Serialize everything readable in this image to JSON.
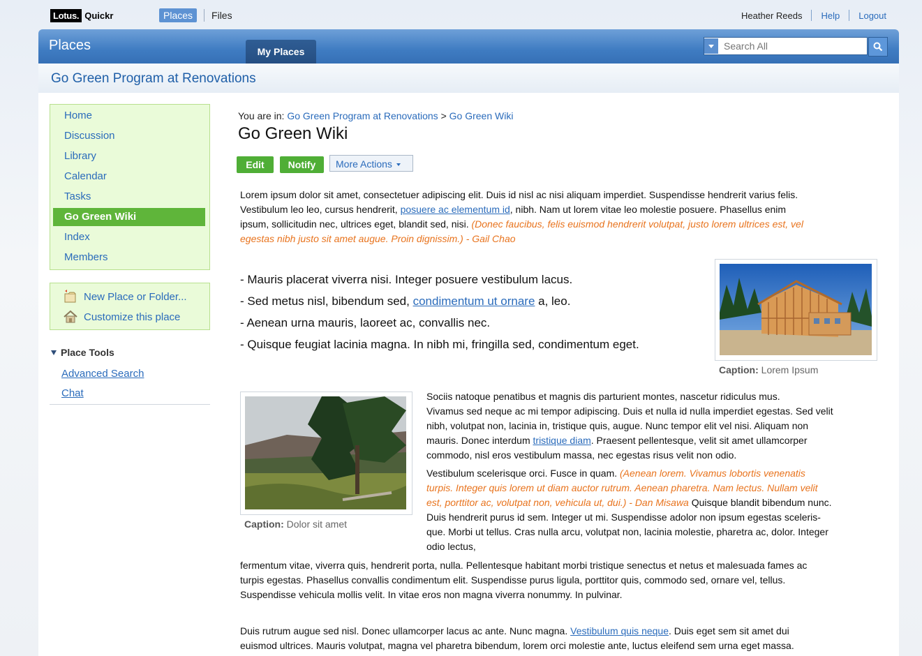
{
  "topbar": {
    "logo_lotus": "Lotus.",
    "logo_quickr": "Quickr",
    "tab_places": "Places",
    "tab_files": "Files",
    "user_name": "Heather Reeds",
    "help": "Help",
    "logout": "Logout"
  },
  "places_bar": {
    "title": "Places",
    "my_places_tab": "My Places",
    "search_placeholder": "Search All"
  },
  "place": {
    "name": "Go Green Program at Renovations"
  },
  "sidebar": {
    "items": [
      {
        "label": "Home"
      },
      {
        "label": "Discussion"
      },
      {
        "label": "Library"
      },
      {
        "label": "Calendar"
      },
      {
        "label": "Tasks"
      },
      {
        "label": "Go Green Wiki"
      },
      {
        "label": "Index"
      },
      {
        "label": "Members"
      }
    ],
    "actions": {
      "new_place": "New Place or Folder...",
      "customize": "Customize this place"
    },
    "tools_header": "Place Tools",
    "tools": {
      "advanced_search": "Advanced Search",
      "chat": "Chat"
    }
  },
  "main": {
    "breadcrumb_prefix": "You are in:",
    "breadcrumb_place": "Go Green Program at Renovations",
    "breadcrumb_sep": ">",
    "breadcrumb_page": "Go Green Wiki",
    "title": "Go Green Wiki",
    "btn_edit": "Edit",
    "btn_notify": "Notify",
    "btn_more": "More Actions",
    "p1_line1": "Lorem ipsum dolor sit amet, consectetuer adipiscing elit. Duis id nisl ac nisi aliquam imperdiet. Suspendisse hendrerit varius felis.",
    "p1_line2_pre": "Vestibulum leo leo, cursus hendrerit, ",
    "p1_link": "posuere ac elementum id",
    "p1_line2_post": ", nibh. Nam ut lorem vitae leo molestie posuere. Phasellus enim",
    "p1_line3_pre": "ipsum, sollicitudin nec, ultrices eget, blandit sed, nisi. ",
    "p1_quote_a": "(Donec faucibus, felis euismod hendrerit volutpat, justo lorem ultrices est, vel",
    "p1_quote_b": "egestas nibh justo sit amet augue. Proin dignissim.) - Gail Chao",
    "bullet1": "- Mauris placerat viverra nisi. Integer posuere vestibulum lacus.",
    "bullet2_pre": "- Sed metus nisl, bibendum sed, ",
    "bullet2_link": "condimentum ut ornare",
    "bullet2_post": " a, leo.",
    "bullet3": "- Aenean urna mauris, laoreet ac, convallis nec.",
    "bullet4": "- Quisque feugiat lacinia magna. In nibh mi, fringilla sed, condimentum eget.",
    "caption_label": "Caption:",
    "caption1": "Lorem Ipsum",
    "caption2": "Dolor sit amet",
    "p2_l1": "Sociis natoque penatibus et magnis dis parturient montes, nascetur ridiculus mus.",
    "p2_l2": "Vivamus sed neque ac mi tempor adipiscing. Duis et nulla id nulla imperdiet egestas. Sed velit",
    "p2_l3": "nibh, volutpat non, lacinia in, tristique quis, augue. Nunc tempor elit vel nisi. Aliquam non",
    "p2_l4_pre": "mauris. Donec interdum ",
    "p2_l4_link": "tristique diam",
    "p2_l4_post": ". Praesent pellentesque, velit sit amet ullamcorper",
    "p2_l5": "commodo, nisl eros vestibulum massa, nec egestas risus velit non odio.",
    "p3_l1_pre": "Vestibulum scelerisque orci. Fusce in quam. ",
    "p3_l1_quote": "(Aenean lorem. Vivamus lobortis venenatis",
    "p3_l2_quote": "turpis. Integer quis lorem ut diam auctor rutrum. Aenean pharetra. Nam lectus. Nullam velit",
    "p3_l3_quote": "est, porttitor ac, volutpat non, vehicula ut, dui.) - Dan Misawa",
    "p3_l3_post": " Quisque blandit bibendum nunc.",
    "p3_l4": "Duis hendrerit purus id sem. Integer ut mi. Suspendisse adolor non ipsum egestas sceleris-",
    "p3_l5": "que. Morbi ut tellus. Cras nulla arcu, volutpat non, lacinia molestie, pharetra ac, dolor. Integer",
    "p3_l6": "odio lectus,",
    "p4_l1": "fermentum vitae, viverra quis, hendrerit porta, nulla. Pellentesque habitant morbi tristique senectus et netus et malesuada fames ac",
    "p4_l2": "turpis egestas. Phasellus convallis condimentum elit. Suspendisse purus ligula, porttitor quis, commodo sed, ornare vel, tellus.",
    "p4_l3": "Suspendisse vehicula mollis velit. In vitae eros non magna viverra nonummy. In pulvinar.",
    "p5_l1_pre": "Duis rutrum augue sed nisl. Donec ullamcorper lacus ac ante. Nunc magna. ",
    "p5_l1_link": "Vestibulum quis neque",
    "p5_l1_post": ". Duis eget sem sit amet dui",
    "p5_l2": "euismod ultrices. Mauris volutpat, magna vel pharetra bibendum, lorem orci molestie ante, luctus eleifend sem urna eget massa."
  },
  "colors": {
    "brand_blue": "#3f7cc2",
    "link": "#2a6bbb",
    "green": "#4fae36",
    "quote_orange": "#e8731d"
  }
}
